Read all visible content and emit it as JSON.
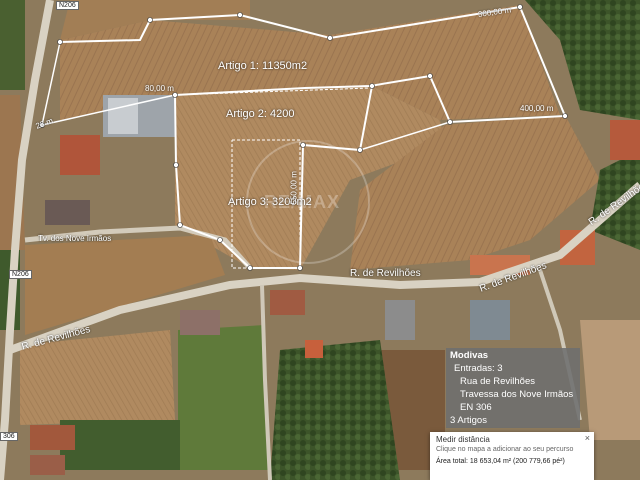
{
  "map": {
    "parcel_labels": {
      "artigo1": "Artigo 1: 11350m2",
      "artigo2": "Artigo 2: 4200",
      "artigo3": "Artigo 3: 3200m2"
    },
    "measurements": {
      "m1": "300,00 m",
      "m2": "400,00 m",
      "m3": "80,00 m",
      "m4": "550,00 m",
      "m5": "23 m"
    },
    "roads": {
      "n206_top": "N206",
      "n206_left": "N206",
      "n306_bottom": "306",
      "travessa": "Tv. dos Nove Irmãos",
      "revilhoes_center": "R. de Revilhões",
      "revilhoes_right": "R. de Revilhões",
      "revilhoes_left": "R. de Revilhões",
      "revilhoes_far_right": "R. de Revilhões"
    },
    "watermark": "RE/MAX",
    "colors": {
      "field_light": "#b08a60",
      "field_dark": "#8a6a44",
      "vegetation": "#3f5a2c",
      "boundary": "#ffffff"
    }
  },
  "info_box": {
    "title": "Modivas",
    "entries_label": "Entradas: 3",
    "entry1": "Rua de Revilhões",
    "entry2": "Travessa dos Nove Irmãos",
    "entry3": "EN 306",
    "artigos": "3 Artigos"
  },
  "measure_card": {
    "title": "Medir distância",
    "subtitle": "Clique no mapa a adicionar ao seu percurso",
    "area": "Área total: 18 653,04 m² (200 779,66 pé²)",
    "close": "×"
  }
}
